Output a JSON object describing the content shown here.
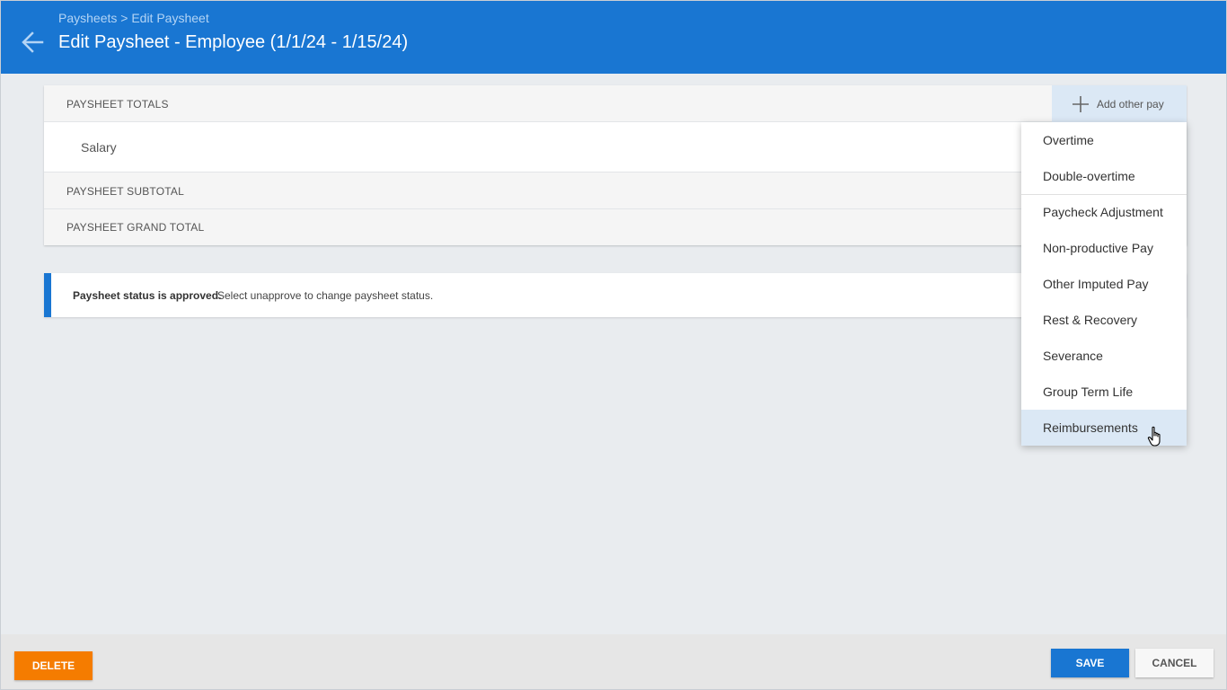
{
  "header": {
    "breadcrumb": "Paysheets > Edit Paysheet",
    "title": "Edit Paysheet - Employee (1/1/24 - 1/15/24)",
    "back_icon": "arrow-left-icon",
    "bg_color": "#1976d2"
  },
  "totals": {
    "header_label": "PAYSHEET TOTALS",
    "salary_label": "Salary",
    "subtotal_label": "PAYSHEET SUBTOTAL",
    "grand_total_label": "PAYSHEET GRAND TOTAL",
    "add_other_pay_label": "Add other pay",
    "add_icon": "plus-icon"
  },
  "status": {
    "bold_text": "Paysheet status is approved.",
    "message": "Select unapprove to change paysheet status.",
    "accent_color": "#1976d2"
  },
  "menu": {
    "items": [
      {
        "label": "Overtime"
      },
      {
        "label": "Double-overtime"
      },
      {
        "label": "Paycheck Adjustment"
      },
      {
        "label": "Non-productive Pay"
      },
      {
        "label": "Other Imputed Pay"
      },
      {
        "label": "Rest & Recovery"
      },
      {
        "label": "Severance"
      },
      {
        "label": "Group Term Life"
      },
      {
        "label": "Reimbursements"
      }
    ],
    "hovered_item": "Reimbursements"
  },
  "footer": {
    "delete_label": "DELETE",
    "save_label": "SAVE",
    "cancel_label": "CANCEL",
    "delete_color": "#f57c00",
    "save_color": "#1976d2"
  }
}
